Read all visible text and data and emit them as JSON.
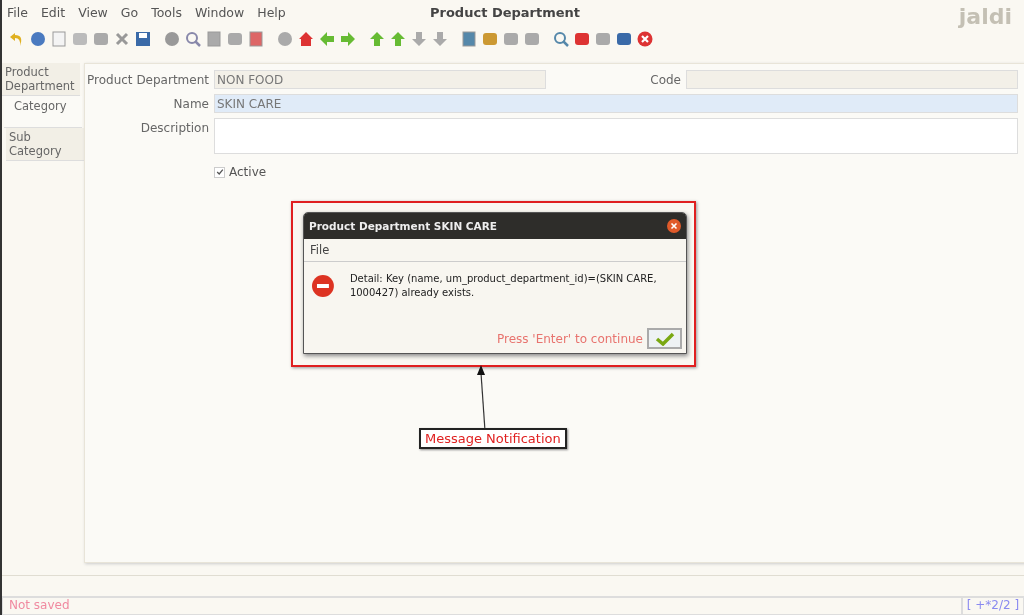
{
  "window": {
    "title": "Product Department",
    "logo": "jaldi"
  },
  "menu": [
    "File",
    "Edit",
    "View",
    "Go",
    "Tools",
    "Window",
    "Help"
  ],
  "side_tabs": [
    {
      "label": "Product Department",
      "selected": false
    },
    {
      "label": "Category",
      "selected": true
    },
    {
      "label": "Sub Category",
      "selected": false
    }
  ],
  "form": {
    "product_department": {
      "label": "Product Department",
      "value": "NON FOOD",
      "disabled": true
    },
    "code": {
      "label": "Code",
      "disabled": true
    },
    "name": {
      "label": "Name",
      "value": "SKIN CARE",
      "focused": true
    },
    "description": {
      "label": "Description"
    },
    "active": {
      "label": "Active",
      "checked": true
    }
  },
  "dialog": {
    "title": "Product Department  SKIN CARE",
    "menu": [
      "File"
    ],
    "message": "Detail: Key (name, um_product_department_id)=(SKIN CARE, 1000427) already exists.",
    "hint": "Press 'Enter' to continue"
  },
  "annotation": {
    "label": "Message Notification"
  },
  "status_bar": {
    "message": "Not saved",
    "record": "[ +*2/2 ]"
  }
}
